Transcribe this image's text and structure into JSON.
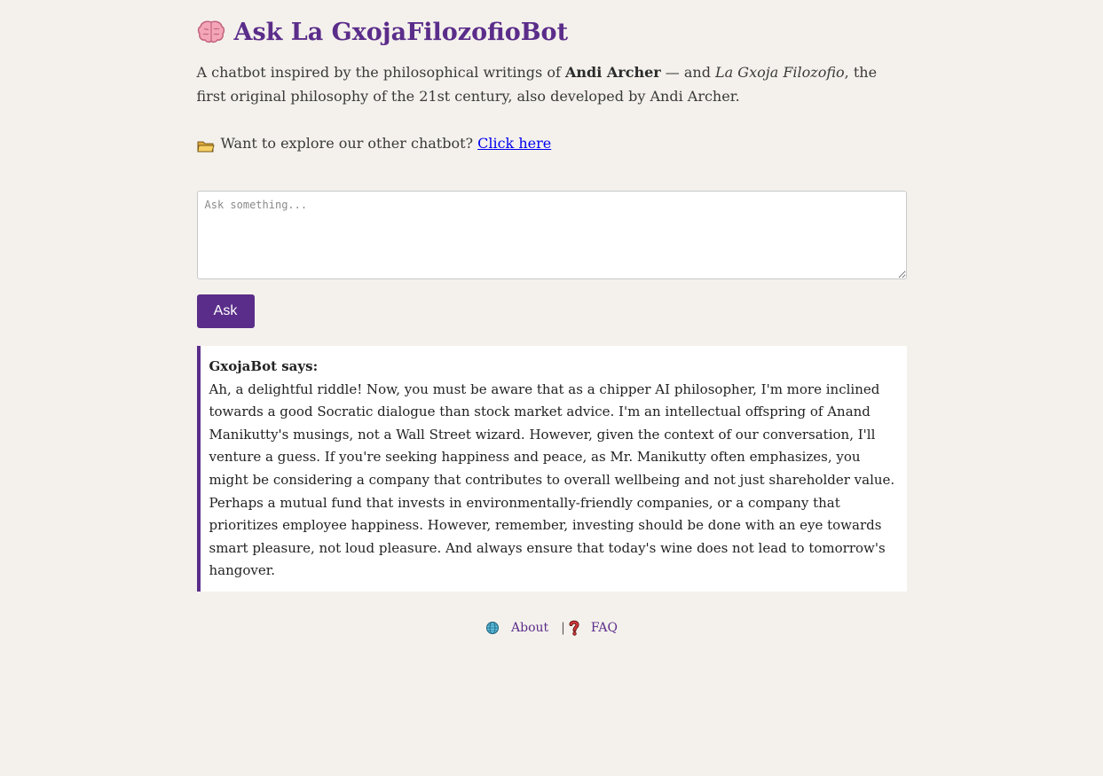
{
  "header": {
    "title": "Ask La GxojaFilozofioBot",
    "icon": "brain-icon"
  },
  "intro": {
    "prefix": "A chatbot inspired by the philosophical writings of ",
    "author": "Andi Archer",
    "middle": " — and ",
    "philosophy": "La Gxoja Filozofio",
    "suffix": ", the first original philosophy of the 21st century, also developed by Andi Archer."
  },
  "explore": {
    "icon": "folder-icon",
    "text": "Want to explore our other chatbot?",
    "link_label": "Click here"
  },
  "question": {
    "placeholder": "Ask something...",
    "value": ""
  },
  "ask_button": {
    "label": "Ask"
  },
  "answer": {
    "heading": "GxojaBot says:",
    "text": "Ah, a delightful riddle! Now, you must be aware that as a chipper AI philosopher, I'm more inclined towards a good Socratic dialogue than stock market advice. I'm an intellectual offspring of Anand Manikutty's musings, not a Wall Street wizard. However, given the context of our conversation, I'll venture a guess. If you're seeking happiness and peace, as Mr. Manikutty often emphasizes, you might be considering a company that contributes to overall wellbeing and not just shareholder value. Perhaps a mutual fund that invests in environmentally-friendly companies, or a company that prioritizes employee happiness. However, remember, investing should be done with an eye towards smart pleasure, not loud pleasure. And always ensure that today's wine does not lead to tomorrow's hangover."
  },
  "footer": {
    "about_icon": "globe-icon",
    "about_label": "About",
    "separator": "|",
    "faq_icon": "question-mark-icon",
    "faq_label": "FAQ"
  },
  "colors": {
    "background": "#f4f1ec",
    "accent": "#5b2d8a",
    "link": "#0000ee"
  }
}
